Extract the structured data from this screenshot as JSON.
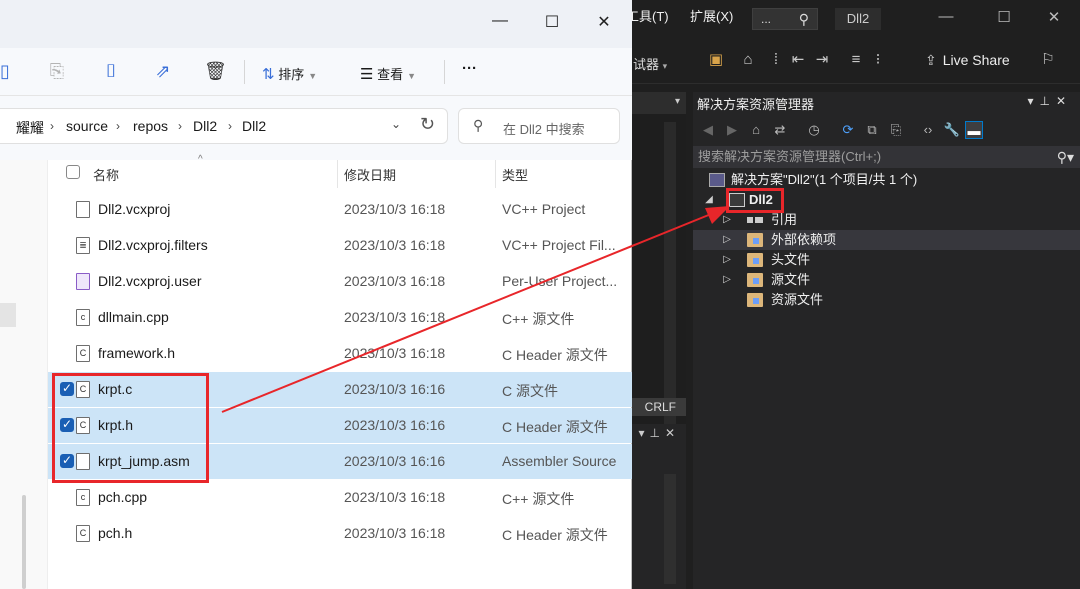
{
  "vs": {
    "menu": {
      "tools": "工具(T)",
      "extensions": "扩展(X)"
    },
    "search_value": "...",
    "solution_name": "Dll2",
    "debugger_label": "试器",
    "live_share": "Live Share",
    "crlf": "CRLF",
    "solution_explorer": {
      "title": "解决方案资源管理器",
      "search_placeholder": "搜索解决方案资源管理器(Ctrl+;)",
      "tree": {
        "solution": "解决方案\"Dll2\"(1 个项目/共 1 个)",
        "project": "Dll2",
        "references": "引用",
        "external_deps": "外部依赖项",
        "headers": "头文件",
        "sources": "源文件",
        "resources": "资源文件"
      }
    }
  },
  "explorer": {
    "toolbar": {
      "sort": "排序",
      "view": "查看",
      "more": "···"
    },
    "breadcrumb": [
      "耀耀",
      "source",
      "repos",
      "Dll2",
      "Dll2"
    ],
    "search_placeholder": "在 Dll2 中搜索",
    "columns": {
      "name": "名称",
      "date": "修改日期",
      "type": "类型"
    },
    "files": [
      {
        "name": "Dll2.vcxproj",
        "date": "2023/10/3 16:18",
        "type": "VC++ Project",
        "selected": false,
        "icon": "vcxproj-icon"
      },
      {
        "name": "Dll2.vcxproj.filters",
        "date": "2023/10/3 16:18",
        "type": "VC++ Project Fil...",
        "selected": false,
        "icon": "filters-icon"
      },
      {
        "name": "Dll2.vcxproj.user",
        "date": "2023/10/3 16:18",
        "type": "Per-User Project...",
        "selected": false,
        "icon": "vs-user-icon"
      },
      {
        "name": "dllmain.cpp",
        "date": "2023/10/3 16:18",
        "type": "C++ 源文件",
        "selected": false,
        "icon": "cpp-file-icon"
      },
      {
        "name": "framework.h",
        "date": "2023/10/3 16:18",
        "type": "C Header 源文件",
        "selected": false,
        "icon": "header-file-icon"
      },
      {
        "name": "krpt.c",
        "date": "2023/10/3 16:16",
        "type": "C 源文件",
        "selected": true,
        "icon": "c-file-icon"
      },
      {
        "name": "krpt.h",
        "date": "2023/10/3 16:16",
        "type": "C Header 源文件",
        "selected": true,
        "icon": "header-file-icon"
      },
      {
        "name": "krpt_jump.asm",
        "date": "2023/10/3 16:16",
        "type": "Assembler Source",
        "selected": true,
        "icon": "asm-file-icon"
      },
      {
        "name": "pch.cpp",
        "date": "2023/10/3 16:18",
        "type": "C++ 源文件",
        "selected": false,
        "icon": "cpp-file-icon"
      },
      {
        "name": "pch.h",
        "date": "2023/10/3 16:18",
        "type": "C Header 源文件",
        "selected": false,
        "icon": "header-file-icon"
      }
    ]
  },
  "colors": {
    "highlight": "#e8262a",
    "selection": "#cce4f7",
    "vs_background": "#1f1f1f"
  }
}
